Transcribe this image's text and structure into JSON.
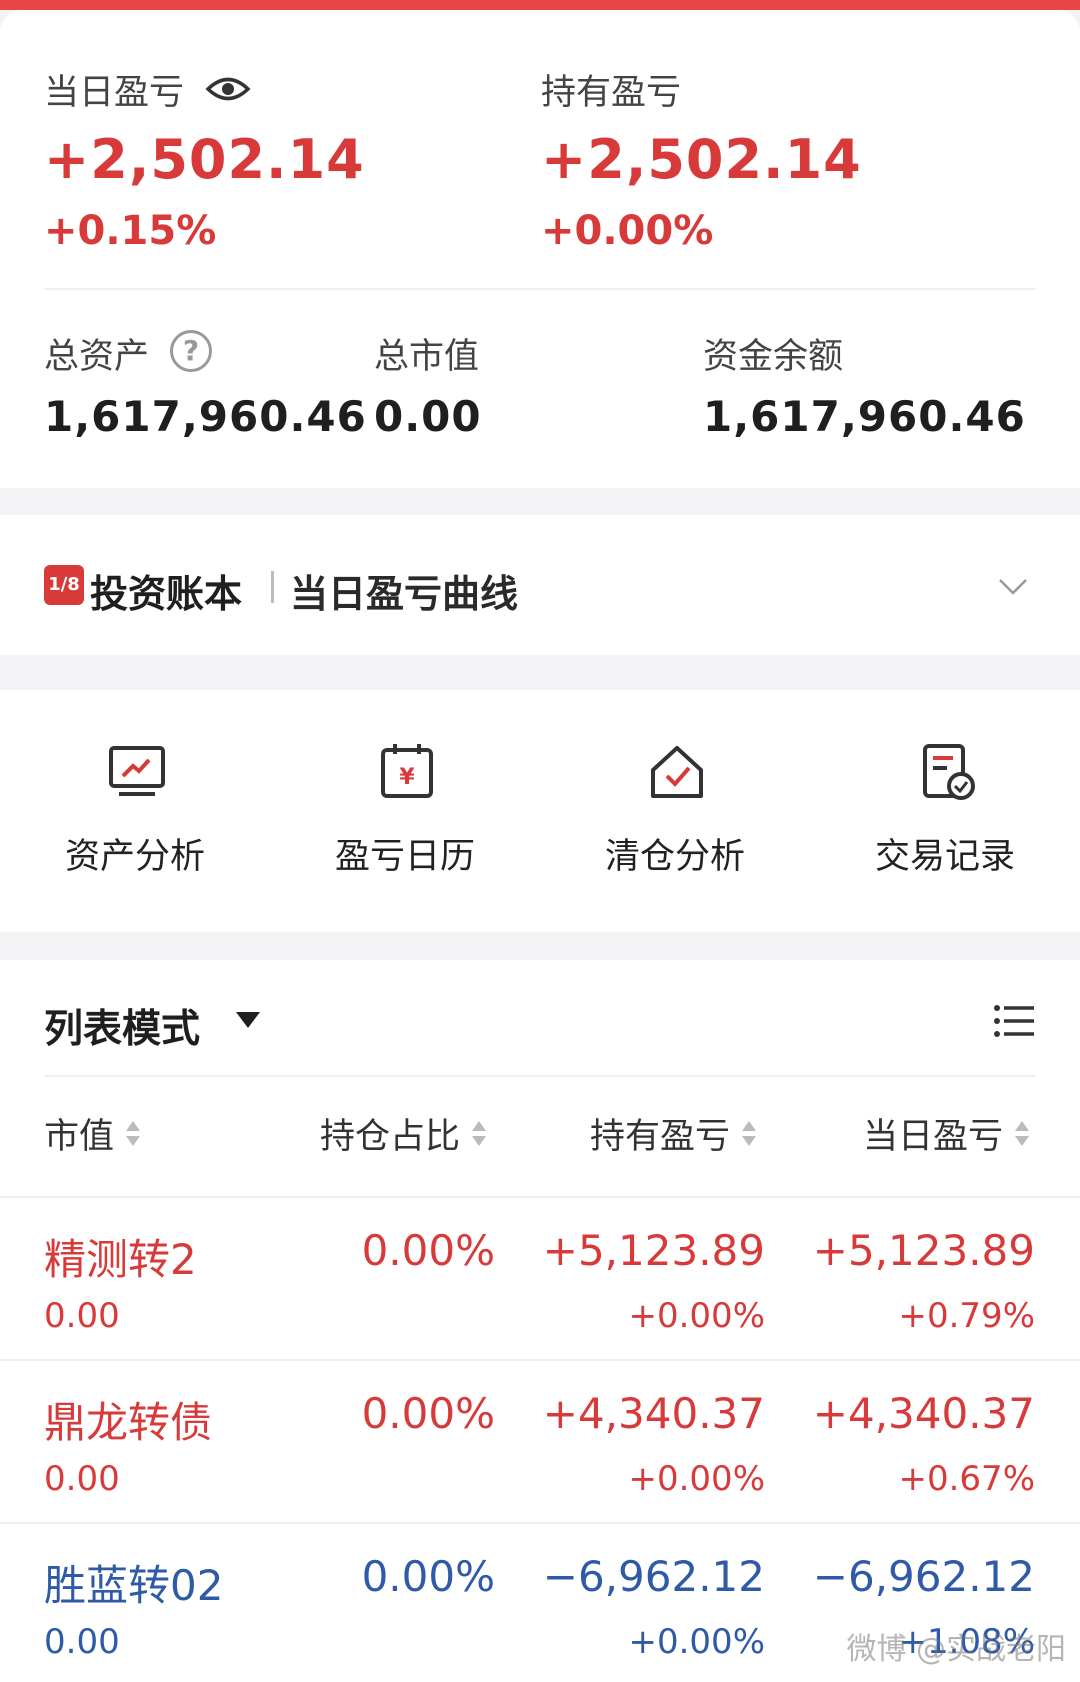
{
  "summary": {
    "daily_pl_label": "当日盈亏",
    "daily_pl_value": "+2,502.14",
    "daily_pl_pct": "+0.15%",
    "holding_pl_label": "持有盈亏",
    "holding_pl_value": "+2,502.14",
    "holding_pl_pct": "+0.00%",
    "total_assets_label": "总资产",
    "total_assets_value": "1,617,960.46",
    "market_value_label": "总市值",
    "market_value_value": "0.00",
    "cash_label": "资金余额",
    "cash_value": "1,617,960.46",
    "help_glyph": "?"
  },
  "ledger": {
    "logo_text": "1∕8",
    "title": "投资账本",
    "subtitle": "当日盈亏曲线"
  },
  "tools": [
    {
      "label": "资产分析",
      "icon": "chart-monitor-icon"
    },
    {
      "label": "盈亏日历",
      "icon": "calendar-yen-icon"
    },
    {
      "label": "清仓分析",
      "icon": "house-check-icon"
    },
    {
      "label": "交易记录",
      "icon": "document-check-icon"
    }
  ],
  "list": {
    "mode_label": "列表模式",
    "columns": [
      "市值",
      "持仓占比",
      "持有盈亏",
      "当日盈亏"
    ],
    "rows": [
      {
        "name": "精测转2",
        "market_value": "0.00",
        "ratio": "0.00%",
        "holding_pl": "+5,123.89",
        "holding_pct": "+0.00%",
        "daily_pl": "+5,123.89",
        "daily_pct": "+0.79%"
      },
      {
        "name": "鼎龙转债",
        "market_value": "0.00",
        "ratio": "0.00%",
        "holding_pl": "+4,340.37",
        "holding_pct": "+0.00%",
        "daily_pl": "+4,340.37",
        "daily_pct": "+0.67%"
      },
      {
        "name": "胜蓝转02",
        "market_value": "0.00",
        "ratio": "0.00%",
        "holding_pl": "−6,962.12",
        "holding_pct": "+0.00%",
        "daily_pl": "−6,962.12",
        "daily_pct": "+1.08%"
      }
    ]
  },
  "watermark": "微博 @实战老阳",
  "colors": {
    "gain": "#d83a3a",
    "loss": "#2f5aa8",
    "accent": "#e84545"
  }
}
